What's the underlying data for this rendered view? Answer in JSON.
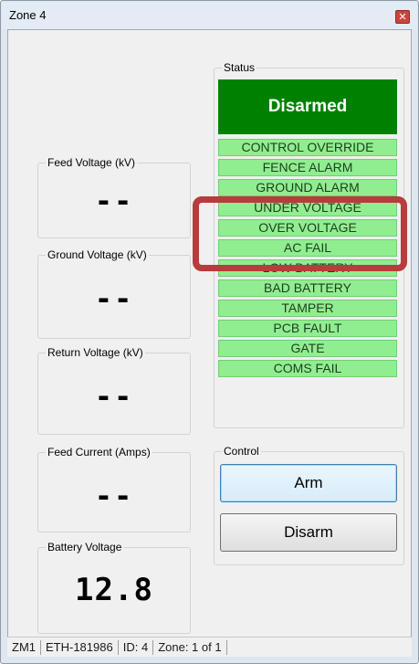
{
  "window": {
    "title": "Zone 4",
    "close_symbol": "✕"
  },
  "readings": [
    {
      "label": "Feed Voltage  (kV)",
      "value": "--"
    },
    {
      "label": "Ground Voltage  (kV)",
      "value": "--"
    },
    {
      "label": "Return Voltage  (kV)",
      "value": "--"
    },
    {
      "label": "Feed Current (Amps)",
      "value": "--"
    },
    {
      "label": "Battery Voltage",
      "value": "12.8"
    }
  ],
  "status": {
    "label": "Status",
    "header": "Disarmed",
    "header_color": "#008000",
    "item_color": "#90ee90",
    "items": [
      "CONTROL OVERRIDE",
      "FENCE ALARM",
      "GROUND ALARM",
      "UNDER VOLTAGE",
      "OVER VOLTAGE",
      "AC FAIL",
      "LOW BATTERY",
      "BAD BATTERY",
      "TAMPER",
      "PCB FAULT",
      "GATE",
      "COMS FAIL"
    ]
  },
  "control": {
    "label": "Control",
    "arm": "Arm",
    "disarm": "Disarm"
  },
  "statusbar": [
    "ZM1",
    "ETH-181986",
    "ID: 4",
    "Zone: 1 of 1"
  ],
  "highlight_color": "#b73c3c"
}
